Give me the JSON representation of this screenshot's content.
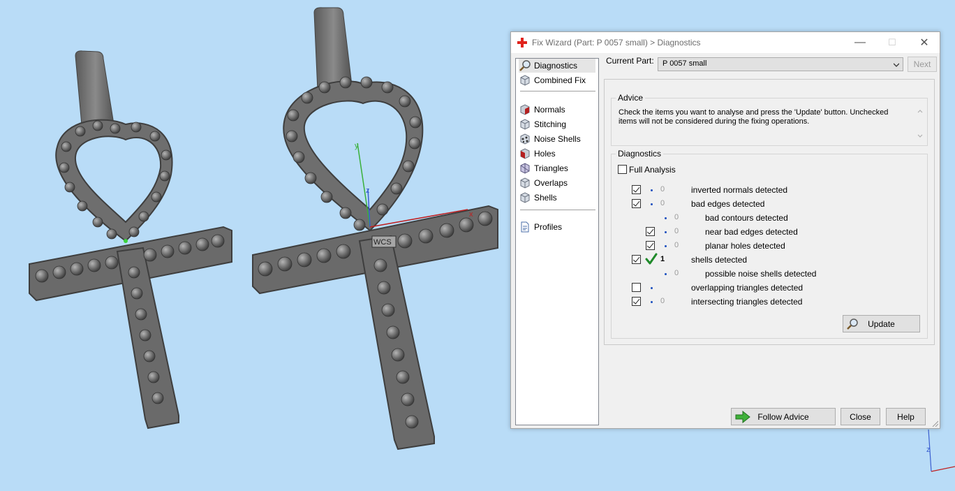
{
  "dialog": {
    "title": "Fix Wizard (Part: P 0057 small) > Diagnostics",
    "title_icon": "red-cross-icon",
    "window_buttons": {
      "minimize": "—",
      "maximize": "☐",
      "close": "✕"
    }
  },
  "nav": {
    "items": [
      {
        "label": "Diagnostics",
        "icon": "magnifier-icon",
        "selected": true
      },
      {
        "label": "Combined Fix",
        "icon": "cube-icon"
      },
      {
        "label": "Normals",
        "icon": "normals-cube-icon"
      },
      {
        "label": "Stitching",
        "icon": "stitching-cube-icon"
      },
      {
        "label": "Noise Shells",
        "icon": "noise-shells-icon"
      },
      {
        "label": "Holes",
        "icon": "holes-cube-icon"
      },
      {
        "label": "Triangles",
        "icon": "triangles-cube-icon"
      },
      {
        "label": "Overlaps",
        "icon": "overlaps-cube-icon"
      },
      {
        "label": "Shells",
        "icon": "shells-cube-icon"
      },
      {
        "label": "Profiles",
        "icon": "document-icon"
      }
    ]
  },
  "current_part": {
    "label": "Current Part:",
    "value": "P 0057 small",
    "next_label": "Next"
  },
  "advice": {
    "title": "Advice",
    "text": "Check the items you want to analyse and press the 'Update' button. Unchecked items will not be considered during the fixing operations."
  },
  "diagnostics": {
    "title": "Diagnostics",
    "full_analysis_label": "Full Analysis",
    "rows": [
      {
        "label": "inverted normals detected",
        "count": "0",
        "checked": true
      },
      {
        "label": "bad edges detected",
        "count": "0",
        "checked": true
      },
      {
        "label": "bad contours detected",
        "count": "0"
      },
      {
        "label": "near bad edges detected",
        "count": "0",
        "checked": true
      },
      {
        "label": "planar holes detected",
        "count": "0",
        "checked": true
      },
      {
        "label": "shells detected",
        "count": "1",
        "checked": true,
        "status_icon": "green-checkmark-icon"
      },
      {
        "label": "possible noise shells detected",
        "count": "0"
      },
      {
        "label": "overlapping triangles detected",
        "count": "",
        "checked": false
      },
      {
        "label": "intersecting triangles detected",
        "count": "0",
        "checked": true
      }
    ],
    "update_label": "Update"
  },
  "footer": {
    "follow_advice_label": "Follow Advice",
    "close_label": "Close",
    "help_label": "Help"
  },
  "viewport": {
    "background": "#b9dcf7",
    "axis_labels": {
      "x": "x",
      "y": "y",
      "z": "z"
    },
    "measure_label": "WCS"
  }
}
